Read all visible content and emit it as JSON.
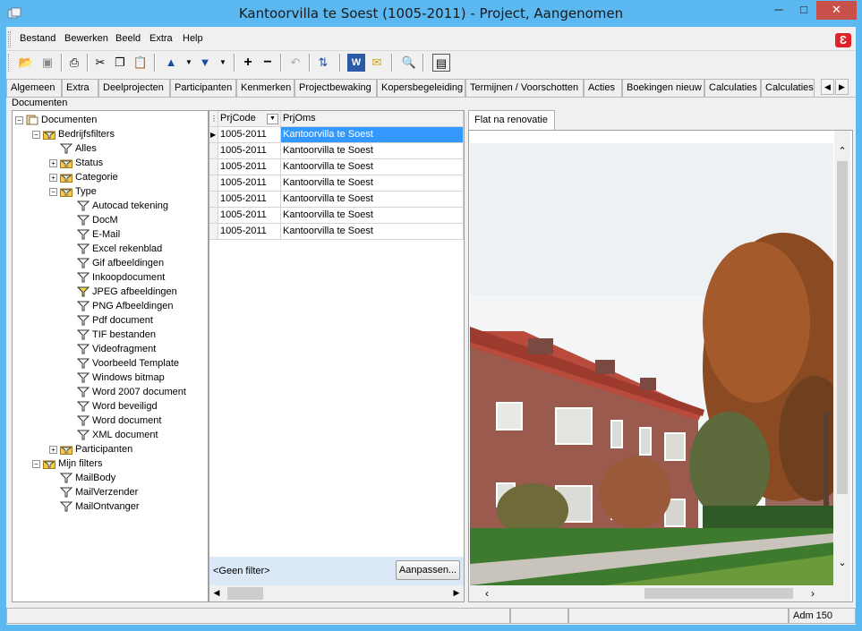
{
  "window": {
    "title": "Kantoorvilla te Soest (1005-2011) - Project, Aangenomen",
    "min_glyph": "─",
    "max_glyph": "□",
    "close_glyph": "✕"
  },
  "menu": {
    "items": [
      "Bestand",
      "Bewerken",
      "Beeld",
      "Extra",
      "Help"
    ],
    "logo_letter": "Ɛ"
  },
  "tabs": {
    "items": [
      "Algemeen",
      "Extra",
      "Deelprojecten",
      "Participanten",
      "Kenmerken",
      "Projectbewaking",
      "Kopersbegeleiding",
      "Termijnen / Voorschotten",
      "Acties",
      "Boekingen nieuw",
      "Calculaties",
      "Calculaties"
    ],
    "active_section": "Documenten"
  },
  "tree": {
    "nodes": [
      {
        "label": "Documenten",
        "icon": "documents-icon"
      },
      {
        "label": "Bedrijfsfilters",
        "icon": "filter-folder-icon"
      },
      {
        "label": "Alles",
        "icon": "filter-icon"
      },
      {
        "label": "Status",
        "icon": "filter-folder-icon"
      },
      {
        "label": "Categorie",
        "icon": "filter-folder-icon"
      },
      {
        "label": "Type",
        "icon": "filter-folder-icon"
      },
      {
        "label": "Autocad tekening",
        "icon": "filter-icon"
      },
      {
        "label": "DocM",
        "icon": "filter-icon"
      },
      {
        "label": "E-Mail",
        "icon": "filter-icon"
      },
      {
        "label": "Excel rekenblad",
        "icon": "filter-icon"
      },
      {
        "label": "Gif afbeeldingen",
        "icon": "filter-icon"
      },
      {
        "label": "Inkoopdocument",
        "icon": "filter-icon"
      },
      {
        "label": "JPEG afbeeldingen",
        "icon": "filter-icon-active"
      },
      {
        "label": "PNG Afbeeldingen",
        "icon": "filter-icon"
      },
      {
        "label": "Pdf document",
        "icon": "filter-icon"
      },
      {
        "label": "TIF bestanden",
        "icon": "filter-icon"
      },
      {
        "label": "Videofragment",
        "icon": "filter-icon"
      },
      {
        "label": "Voorbeeld Template",
        "icon": "filter-icon"
      },
      {
        "label": "Windows bitmap",
        "icon": "filter-icon"
      },
      {
        "label": "Word 2007 document",
        "icon": "filter-icon"
      },
      {
        "label": "Word beveiligd",
        "icon": "filter-icon"
      },
      {
        "label": "Word document",
        "icon": "filter-icon"
      },
      {
        "label": "XML document",
        "icon": "filter-icon"
      },
      {
        "label": "Participanten",
        "icon": "filter-folder-icon"
      },
      {
        "label": "Mijn filters",
        "icon": "filter-folder-icon"
      },
      {
        "label": "MailBody",
        "icon": "filter-icon"
      },
      {
        "label": "MailVerzender",
        "icon": "filter-icon"
      },
      {
        "label": "MailOntvanger",
        "icon": "filter-icon"
      }
    ]
  },
  "grid": {
    "columns": [
      "PrjCode",
      "PrjOms"
    ],
    "rows": [
      [
        "1005-2011",
        "Kantoorvilla te Soest"
      ],
      [
        "1005-2011",
        "Kantoorvilla te Soest"
      ],
      [
        "1005-2011",
        "Kantoorvilla te Soest"
      ],
      [
        "1005-2011",
        "Kantoorvilla te Soest"
      ],
      [
        "1005-2011",
        "Kantoorvilla te Soest"
      ],
      [
        "1005-2011",
        "Kantoorvilla te Soest"
      ],
      [
        "1005-2011",
        "Kantoorvilla te Soest"
      ]
    ],
    "filter_label": "<Geen filter>",
    "customize_label": "Aanpassen..."
  },
  "preview": {
    "tab_label": "Flat na renovatie",
    "image_subject": "brick-rowhouse-photo"
  },
  "status": {
    "user": "Adm 150"
  },
  "colors": {
    "titlebar": "#5cb8f0",
    "selection": "#3399ff",
    "footer": "#dbe8f8",
    "close": "#c7504b"
  }
}
